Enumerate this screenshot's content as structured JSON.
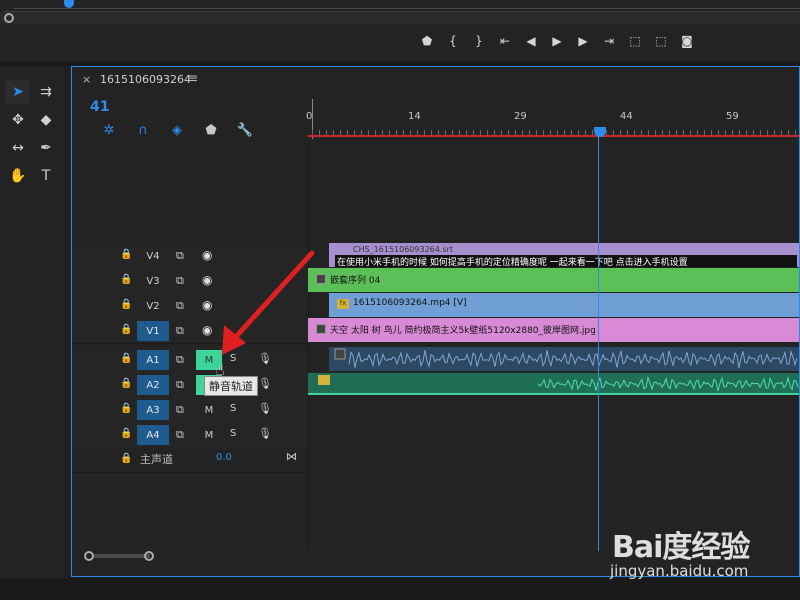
{
  "monitor": {
    "transport_buttons": [
      {
        "name": "add-marker-icon",
        "glyph": "⬟"
      },
      {
        "name": "mark-in-icon",
        "glyph": "{"
      },
      {
        "name": "mark-out-icon",
        "glyph": "}"
      },
      {
        "name": "go-to-in-icon",
        "glyph": "⇤"
      },
      {
        "name": "step-back-icon",
        "glyph": "◀"
      },
      {
        "name": "play-icon",
        "glyph": "▶"
      },
      {
        "name": "step-forward-icon",
        "glyph": "▶"
      },
      {
        "name": "go-to-out-icon",
        "glyph": "⇥"
      },
      {
        "name": "lift-icon",
        "glyph": "⬚"
      },
      {
        "name": "extract-icon",
        "glyph": "⬚"
      },
      {
        "name": "export-frame-icon",
        "glyph": "◙"
      }
    ]
  },
  "tools": [
    {
      "name": "selection-tool-icon",
      "glyph": "➤",
      "active": true
    },
    {
      "name": "track-select-tool-icon",
      "glyph": "⇉"
    },
    {
      "name": "ripple-edit-tool-icon",
      "glyph": "✥"
    },
    {
      "name": "razor-tool-icon",
      "glyph": "◆"
    },
    {
      "name": "slip-tool-icon",
      "glyph": "↔"
    },
    {
      "name": "pen-tool-icon",
      "glyph": "✒"
    },
    {
      "name": "hand-tool-icon",
      "glyph": "✋"
    },
    {
      "name": "type-tool-icon",
      "glyph": "T"
    }
  ],
  "timeline": {
    "close_glyph": "×",
    "title": "1615106093264",
    "menu_glyph": "≡",
    "timecode": "41",
    "tool_icons": [
      {
        "name": "nest-icon",
        "glyph": "✲"
      },
      {
        "name": "snap-icon",
        "glyph": "∩"
      },
      {
        "name": "linked-selection-icon",
        "glyph": "◈"
      },
      {
        "name": "add-marker-icon",
        "glyph": "⬟",
        "grey": true
      },
      {
        "name": "settings-wrench-icon",
        "glyph": "🔧",
        "grey": true
      }
    ],
    "ruler_labels": [
      "0",
      "14",
      "29",
      "44",
      "59"
    ],
    "tracks": [
      {
        "name": "V4",
        "type": "video",
        "on": false
      },
      {
        "name": "V3",
        "type": "video",
        "on": false
      },
      {
        "name": "V2",
        "type": "video",
        "on": false
      },
      {
        "name": "V1",
        "type": "video",
        "on": true
      },
      {
        "name": "A1",
        "type": "audio",
        "on": true,
        "mute": "M",
        "mute_on": true,
        "solo": "S"
      },
      {
        "name": "A2",
        "type": "audio",
        "on": true,
        "mute": "M",
        "mute_on": true,
        "solo": "S"
      },
      {
        "name": "A3",
        "type": "audio",
        "on": true,
        "mute": "M",
        "mute_on": false,
        "solo": "S"
      },
      {
        "name": "A4",
        "type": "audio",
        "on": true,
        "mute": "M",
        "mute_on": false,
        "solo": "S"
      }
    ],
    "master": {
      "label": "主声道",
      "value": "0.0"
    },
    "tooltip": "静音轨道",
    "clips": {
      "v4_name": "CHS_1615106093264.srt",
      "v4_subtitle": "在使用小米手机的时候 如何提高手机的定位精确度呢 一起来看一下吧 点击进入手机设置",
      "v3": "嵌套序列 04",
      "v2": "1615106093264.mp4 [V]",
      "v1": "天空 太阳 树 鸟儿 简约极简主义5k壁纸5120x2880_彼岸图网.jpg"
    }
  },
  "watermark": {
    "logo": "Bai度经验",
    "url": "jingyan.baidu.com"
  }
}
